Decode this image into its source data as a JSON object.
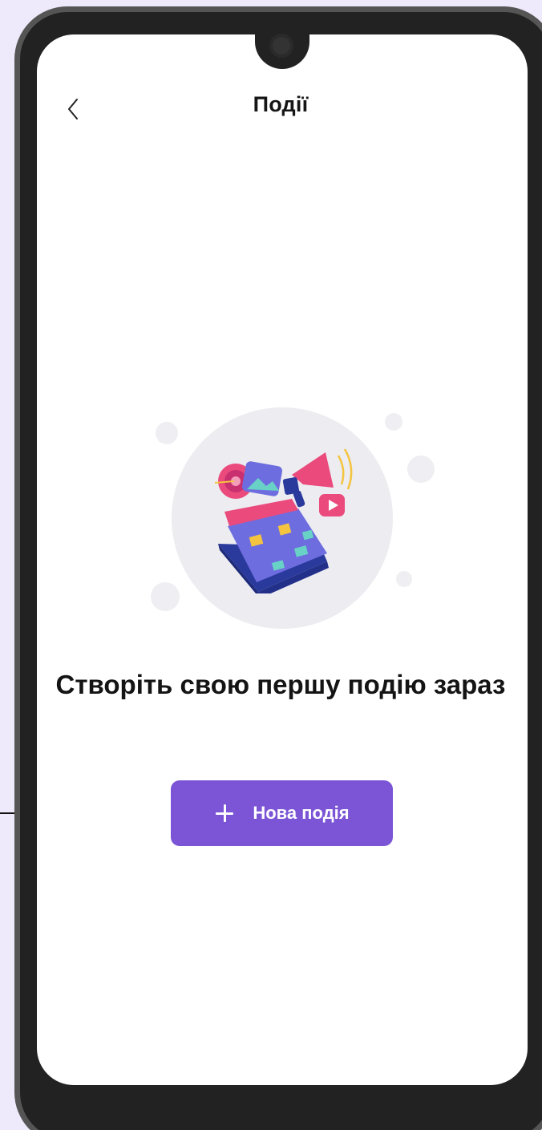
{
  "header": {
    "title": "Події"
  },
  "main": {
    "empty_message": "Створіть свою першу подію зараз",
    "new_event_button_label": "Нова подія"
  },
  "icons": {
    "back": "chevron-left-icon",
    "add": "plus-icon",
    "illustration": "events-illustration-icon"
  },
  "colors": {
    "accent": "#7b55d6",
    "background": "#efeafb",
    "bezel": "#222222"
  }
}
